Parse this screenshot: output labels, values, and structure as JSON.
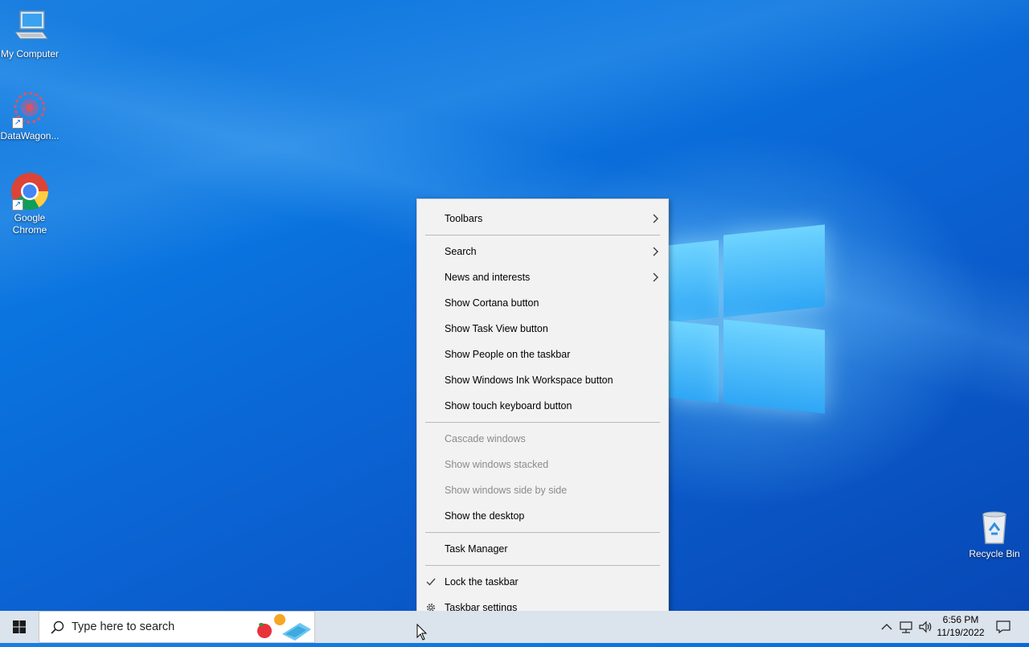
{
  "desktop": {
    "icons": [
      {
        "label": "My Computer"
      },
      {
        "label": "DataWagon..."
      },
      {
        "label": "Google Chrome"
      },
      {
        "label": "Recycle Bin"
      }
    ]
  },
  "context_menu": {
    "items": [
      {
        "label": "Toolbars",
        "submenu": true,
        "enabled": true
      },
      {
        "label": "Search",
        "submenu": true,
        "enabled": true
      },
      {
        "label": "News and interests",
        "submenu": true,
        "enabled": true
      },
      {
        "label": "Show Cortana button",
        "enabled": true
      },
      {
        "label": "Show Task View button",
        "enabled": true
      },
      {
        "label": "Show People on the taskbar",
        "enabled": true
      },
      {
        "label": "Show Windows Ink Workspace button",
        "enabled": true
      },
      {
        "label": "Show touch keyboard button",
        "enabled": true
      },
      {
        "label": "Cascade windows",
        "enabled": false
      },
      {
        "label": "Show windows stacked",
        "enabled": false
      },
      {
        "label": "Show windows side by side",
        "enabled": false
      },
      {
        "label": "Show the desktop",
        "enabled": true
      },
      {
        "label": "Task Manager",
        "enabled": true
      },
      {
        "label": "Lock the taskbar",
        "checked": true,
        "enabled": true
      },
      {
        "label": "Taskbar settings",
        "icon": "gear-icon",
        "enabled": true
      }
    ]
  },
  "taskbar": {
    "search_placeholder": "Type here to search",
    "clock_time": "6:56 PM",
    "clock_date": "11/19/2022",
    "tray_icons": [
      "chevron-up-icon",
      "network-icon",
      "volume-icon",
      "notification-icon"
    ]
  },
  "colors": {
    "desktop_blue": "#0a74df",
    "menu_bg": "#f2f2f2",
    "taskbar_bg": "#dbe3ec",
    "disabled_text": "#8b8b8b"
  }
}
